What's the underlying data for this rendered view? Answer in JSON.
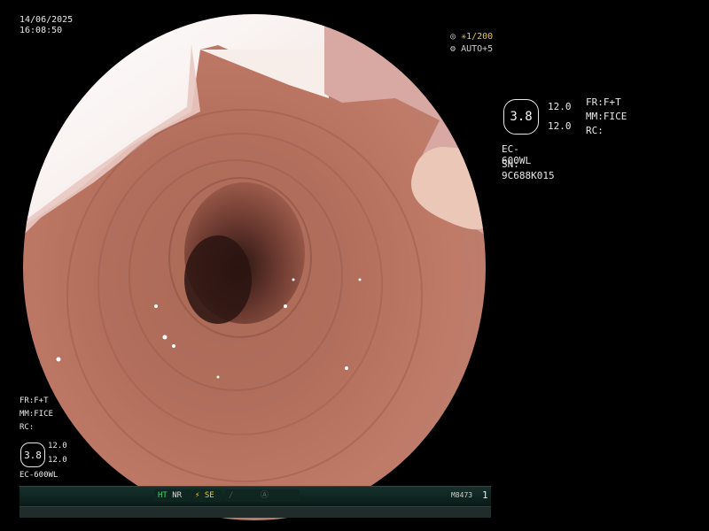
{
  "datetime": {
    "date": "14/06/2025",
    "time": "16:08:50"
  },
  "shutter": {
    "speed": "1/200",
    "mode": "AUTO+5"
  },
  "right_info": {
    "hex_value": "3.8",
    "n1": "12.0",
    "n2": "12.0",
    "fr": "FR:F+T",
    "mm": "MM:FICE",
    "rc": "RC:",
    "model": "EC-600WL",
    "serial": "SN: 9C688K015"
  },
  "left_info": {
    "fr": "FR:F+T",
    "mm": "MM:FICE",
    "rc": "RC:",
    "hex_value": "3.8",
    "n1": "12.0",
    "n2": "12.0",
    "model": "EC-600WL"
  },
  "statusbar": {
    "ht": "HT",
    "nr": "NR",
    "se": "SE",
    "code": "M8473",
    "page": "1"
  },
  "colors": {
    "background": "#000000",
    "status_green": "#3fd36a",
    "status_yellow": "#e8cf3f"
  }
}
